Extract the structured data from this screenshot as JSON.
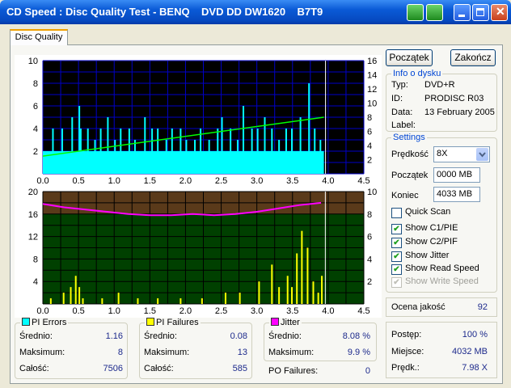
{
  "window": {
    "title": "CD Speed : Disc Quality Test - BENQ    DVD DD DW1620    B7T9"
  },
  "tabs": [
    {
      "label": "Disc Quality"
    }
  ],
  "buttons": {
    "start": "Początek",
    "end": "Zakończ"
  },
  "info": {
    "title": "Info o dysku",
    "rows": [
      {
        "label": "Typ:",
        "value": "DVD+R"
      },
      {
        "label": "ID:",
        "value": "PRODISC R03"
      },
      {
        "label": "Data:",
        "value": "13 February 2005"
      },
      {
        "label": "Label:",
        "value": ""
      }
    ]
  },
  "settings": {
    "title": "Settings",
    "speed_label": "Prędkość",
    "speed_value": "8X",
    "start_label": "Początek",
    "start_value": "0000 MB",
    "end_label": "Koniec",
    "end_value": "4033 MB",
    "checks": [
      {
        "label": "Quick Scan",
        "checked": false,
        "disabled": false
      },
      {
        "label": "Show C1/PIE",
        "checked": true,
        "disabled": false
      },
      {
        "label": "Show C2/PIF",
        "checked": true,
        "disabled": false
      },
      {
        "label": "Show Jitter",
        "checked": true,
        "disabled": false
      },
      {
        "label": "Show Read Speed",
        "checked": true,
        "disabled": false
      },
      {
        "label": "Show Write Speed",
        "checked": true,
        "disabled": true
      }
    ]
  },
  "quality": {
    "label": "Ocena jakość",
    "value": "92"
  },
  "progress": {
    "rows": [
      {
        "label": "Postęp:",
        "value": "100 %"
      },
      {
        "label": "Miejsce:",
        "value": "4032 MB"
      },
      {
        "label": "Prędk.:",
        "value": "7.98 X"
      }
    ]
  },
  "stats": {
    "pi_errors": {
      "title": "PI Errors",
      "color": "#00ffff",
      "rows": [
        {
          "label": "Średnio:",
          "value": "1.16"
        },
        {
          "label": "Maksimum:",
          "value": "8"
        },
        {
          "label": "Całość:",
          "value": "7506"
        }
      ]
    },
    "pi_failures": {
      "title": "PI Failures",
      "color": "#ffff00",
      "rows": [
        {
          "label": "Średnio:",
          "value": "0.08"
        },
        {
          "label": "Maksimum:",
          "value": "13"
        },
        {
          "label": "Całość:",
          "value": "585"
        }
      ]
    },
    "jitter": {
      "title": "Jitter",
      "color": "#ff00ff",
      "rows": [
        {
          "label": "Średnio:",
          "value": "8.08 %"
        },
        {
          "label": "Maksimum:",
          "value": "9.9 %"
        }
      ]
    },
    "po_failures": {
      "label": "PO Failures:",
      "value": "0"
    }
  },
  "chart_data": [
    {
      "type": "bar",
      "x_range": [
        0,
        4.5
      ],
      "x_ticks": [
        "0.0",
        "0.5",
        "1.0",
        "1.5",
        "2.0",
        "2.5",
        "3.0",
        "3.5",
        "4.0",
        "4.5"
      ],
      "y_left_range": [
        0,
        10
      ],
      "y_left_ticks": [
        "2",
        "4",
        "6",
        "8",
        "10"
      ],
      "y_right_range": [
        0,
        16
      ],
      "y_right_ticks": [
        "2",
        "4",
        "6",
        "8",
        "10",
        "12",
        "14",
        "16"
      ],
      "grid": true,
      "series": [
        {
          "values_note": "",
          "color": "#00ffff",
          "x_end": 3.94,
          "baseline": 2,
          "peaks": [
            [
              0.13,
              4
            ],
            [
              0.26,
              4
            ],
            [
              0.4,
              5
            ],
            [
              0.5,
              6
            ],
            [
              0.52,
              4
            ],
            [
              0.62,
              4
            ],
            [
              0.72,
              3
            ],
            [
              0.8,
              4
            ],
            [
              0.9,
              5
            ],
            [
              1.0,
              3
            ],
            [
              1.08,
              4
            ],
            [
              1.2,
              4
            ],
            [
              1.28,
              3
            ],
            [
              1.42,
              5
            ],
            [
              1.52,
              4
            ],
            [
              1.6,
              4
            ],
            [
              1.72,
              3
            ],
            [
              1.8,
              4
            ],
            [
              1.92,
              4
            ],
            [
              2.0,
              3
            ],
            [
              2.12,
              3
            ],
            [
              2.2,
              4
            ],
            [
              2.32,
              3
            ],
            [
              2.44,
              4
            ],
            [
              2.5,
              5
            ],
            [
              2.62,
              4
            ],
            [
              2.72,
              3
            ],
            [
              2.8,
              6
            ],
            [
              2.92,
              4
            ],
            [
              3.0,
              4
            ],
            [
              3.1,
              5
            ],
            [
              3.2,
              4
            ],
            [
              3.3,
              3
            ],
            [
              3.4,
              4
            ],
            [
              3.48,
              4
            ],
            [
              3.6,
              5
            ],
            [
              3.72,
              8
            ],
            [
              3.8,
              4
            ],
            [
              3.88,
              3
            ]
          ],
          "speed_start": 2.5,
          "speed_end": 8.0,
          "speed_color": "#00ff00"
        }
      ]
    },
    {
      "type": "bar",
      "x_range": [
        0,
        4.5
      ],
      "x_ticks": [
        "0.0",
        "0.5",
        "1.0",
        "1.5",
        "2.0",
        "2.5",
        "3.0",
        "3.5",
        "4.0",
        "4.5"
      ],
      "y_left_range": [
        0,
        20
      ],
      "y_left_ticks": [
        "4",
        "8",
        "12",
        "16",
        "20"
      ],
      "y_right_range": [
        0,
        10
      ],
      "y_right_ticks": [
        "2",
        "4",
        "6",
        "8",
        "10"
      ],
      "grid": true,
      "series": [
        {
          "color": "#ffff00",
          "peaks": [
            [
              0.1,
              1
            ],
            [
              0.28,
              2
            ],
            [
              0.38,
              3
            ],
            [
              0.45,
              5
            ],
            [
              0.5,
              3
            ],
            [
              0.55,
              1
            ],
            [
              0.82,
              1
            ],
            [
              1.05,
              2
            ],
            [
              1.32,
              1
            ],
            [
              1.6,
              1
            ],
            [
              1.92,
              1
            ],
            [
              2.22,
              1
            ],
            [
              2.55,
              2
            ],
            [
              2.75,
              2
            ],
            [
              3.02,
              4
            ],
            [
              3.2,
              7
            ],
            [
              3.3,
              3
            ],
            [
              3.42,
              5
            ],
            [
              3.48,
              3
            ],
            [
              3.55,
              9
            ],
            [
              3.62,
              13
            ],
            [
              3.7,
              10
            ],
            [
              3.78,
              4
            ],
            [
              3.85,
              2
            ],
            [
              3.9,
              5
            ]
          ]
        },
        {
          "color": "#ff00ff",
          "jitter_points": [
            [
              0.0,
              8.9
            ],
            [
              0.3,
              8.6
            ],
            [
              0.6,
              8.4
            ],
            [
              0.9,
              8.2
            ],
            [
              1.2,
              8.0
            ],
            [
              1.5,
              7.9
            ],
            [
              1.8,
              7.9
            ],
            [
              2.1,
              8.0
            ],
            [
              2.4,
              7.9
            ],
            [
              2.7,
              8.0
            ],
            [
              3.0,
              8.2
            ],
            [
              3.3,
              8.5
            ],
            [
              3.6,
              8.8
            ],
            [
              3.9,
              9.0
            ]
          ]
        }
      ]
    }
  ]
}
